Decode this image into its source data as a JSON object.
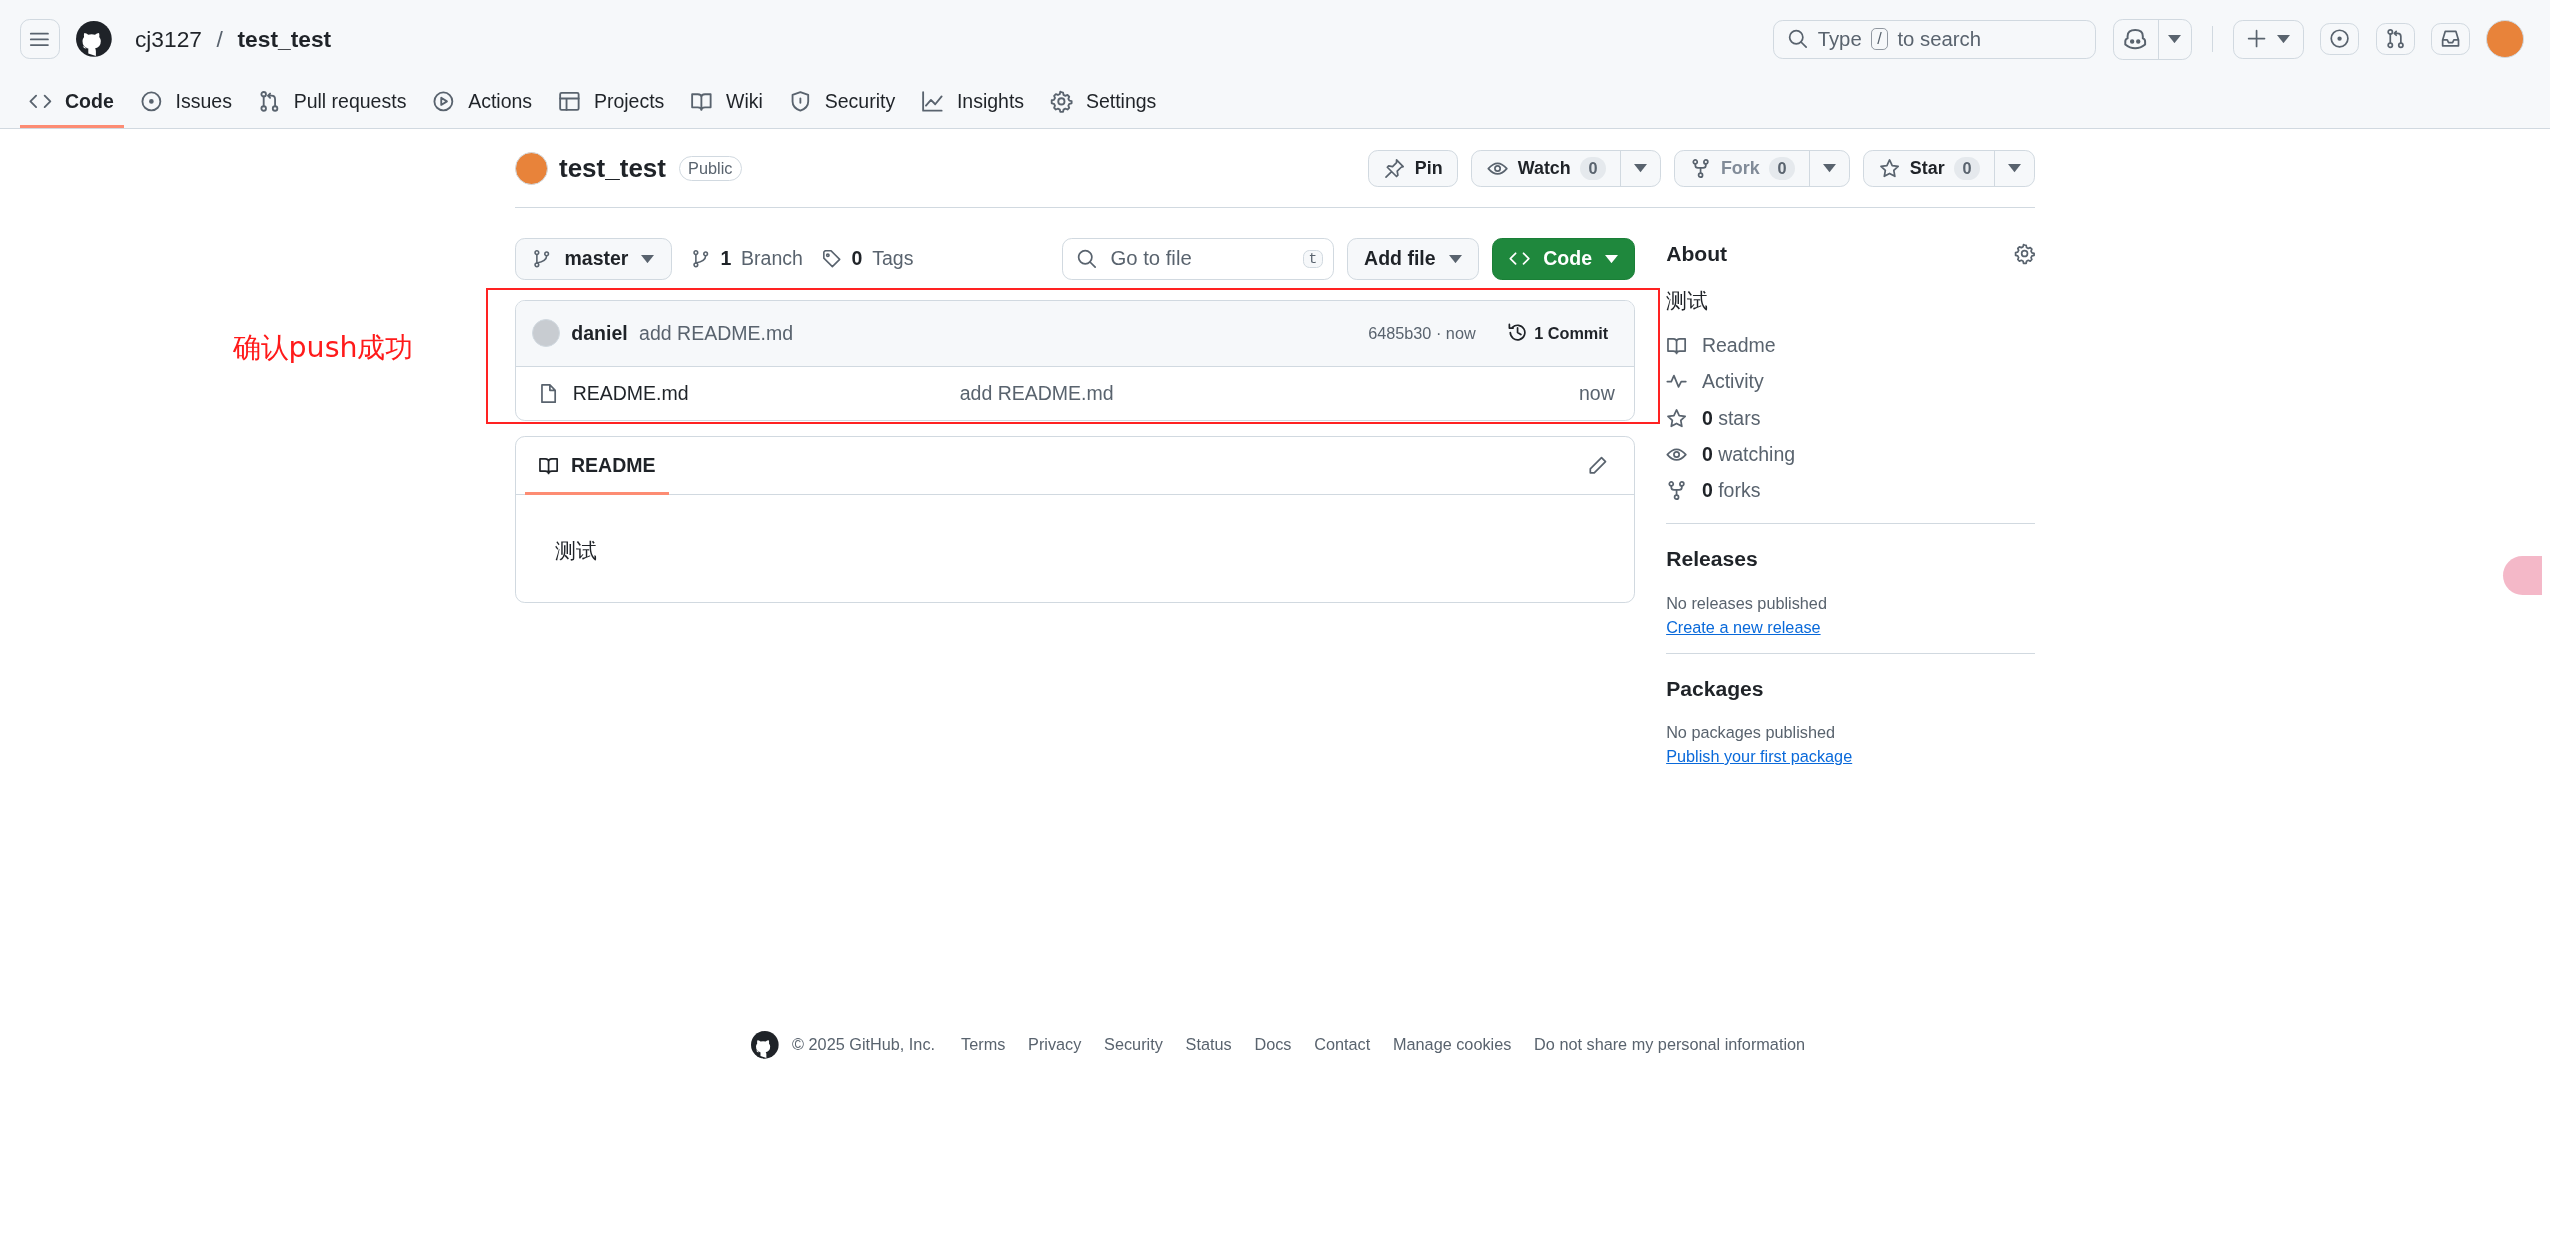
{
  "header": {
    "owner": "cj3127",
    "separator": "/",
    "repo": "test_test",
    "search": {
      "before": "Type",
      "key": "/",
      "after": "to search"
    }
  },
  "nav_tabs": [
    {
      "label": "Code",
      "selected": true
    },
    {
      "label": "Issues",
      "selected": false
    },
    {
      "label": "Pull requests",
      "selected": false
    },
    {
      "label": "Actions",
      "selected": false
    },
    {
      "label": "Projects",
      "selected": false
    },
    {
      "label": "Wiki",
      "selected": false
    },
    {
      "label": "Security",
      "selected": false
    },
    {
      "label": "Insights",
      "selected": false
    },
    {
      "label": "Settings",
      "selected": false
    }
  ],
  "repo": {
    "name": "test_test",
    "visibility": "Public",
    "actions": [
      {
        "label": "Pin",
        "disabled": false
      },
      {
        "label": "Watch",
        "count": "0",
        "disabled": false
      },
      {
        "label": "Fork",
        "count": "0",
        "disabled": true
      },
      {
        "label": "Star",
        "count": "0",
        "disabled": false
      }
    ]
  },
  "toolbar": {
    "branch": "master",
    "branches": {
      "count": "1",
      "label": "Branch"
    },
    "tags": {
      "count": "0",
      "label": "Tags"
    },
    "go_to_file": {
      "placeholder": "Go to file",
      "key": "t"
    },
    "add_file": "Add file",
    "code_button": "Code"
  },
  "commit_bar": {
    "author": "daniel",
    "message": "add README.md",
    "sha_time": "6485b30 · now",
    "commits": "1 Commit"
  },
  "files": [
    {
      "name": "README.md",
      "message": "add README.md",
      "time": "now"
    }
  ],
  "readme": {
    "tab": "README",
    "content": "测试"
  },
  "about": {
    "title": "About",
    "description": "测试",
    "links": [
      {
        "label": "Readme"
      },
      {
        "label": "Activity"
      },
      {
        "count": "0",
        "label": "stars"
      },
      {
        "count": "0",
        "label": "watching"
      },
      {
        "count": "0",
        "label": "forks"
      }
    ]
  },
  "releases": {
    "title": "Releases",
    "note": "No releases published",
    "link": "Create a new release"
  },
  "packages": {
    "title": "Packages",
    "note": "No packages published",
    "link": "Publish your first package"
  },
  "footer": {
    "copyright": "© 2025 GitHub, Inc.",
    "links": [
      "Terms",
      "Privacy",
      "Security",
      "Status",
      "Docs",
      "Contact",
      "Manage cookies",
      "Do not share my personal information"
    ]
  },
  "annotation": {
    "text": "确认push成功"
  }
}
